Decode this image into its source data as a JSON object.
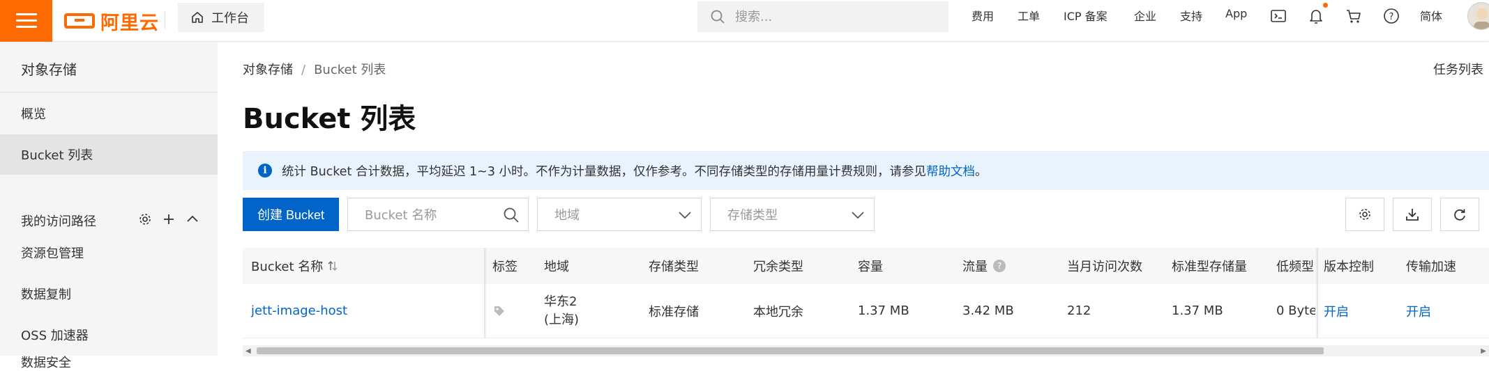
{
  "topbar": {
    "logo_text": "阿里云",
    "workbench_label": "工作台",
    "search_placeholder": "搜索...",
    "links": [
      "费用",
      "工单",
      "ICP 备案",
      "企业",
      "支持",
      "App"
    ],
    "language_label": "简体",
    "accent_color": "#ff6a00"
  },
  "sidebar": {
    "title": "对象存储",
    "items": [
      {
        "label": "概览"
      },
      {
        "label": "Bucket 列表"
      }
    ],
    "group_label": "我的访问路径",
    "items2": [
      {
        "label": "资源包管理"
      },
      {
        "label": "数据复制"
      },
      {
        "label": "OSS 加速器"
      },
      {
        "label": "数据安全"
      }
    ]
  },
  "main": {
    "breadcrumb": [
      "对象存储",
      "Bucket 列表"
    ],
    "task_list_label": "任务列表",
    "page_title": "Bucket 列表",
    "notice": {
      "text": "统计 Bucket 合计数据，平均延迟 1~3 小时。不作为计量数据，仅作参考。不同存储类型的存储用量计费规则，请参见",
      "link": "帮助文档",
      "end": "。"
    },
    "toolbar": {
      "create_label": "创建 Bucket",
      "name_placeholder": "Bucket 名称",
      "region_placeholder": "地域",
      "storage_type_placeholder": "存储类型"
    },
    "table": {
      "headers": [
        "Bucket 名称",
        "标签",
        "地域",
        "存储类型",
        "冗余类型",
        "容量",
        "流量",
        "当月访问次数",
        "标准型存储量",
        "低频型",
        "版本控制",
        "传输加速"
      ],
      "rows": [
        {
          "name": "jett-image-host",
          "region_line1": "华东2",
          "region_line2": "(上海)",
          "storage_type": "标准存储",
          "redundancy": "本地冗余",
          "capacity": "1.37 MB",
          "traffic": "3.42 MB",
          "monthly_visits": "212",
          "standard_storage": "1.37 MB",
          "ia_storage": "0 Byte",
          "versioning": "开启",
          "acceleration": "开启"
        }
      ]
    }
  },
  "colors": {
    "primary": "#0064c8",
    "notice_bg": "#e8f3fd"
  }
}
